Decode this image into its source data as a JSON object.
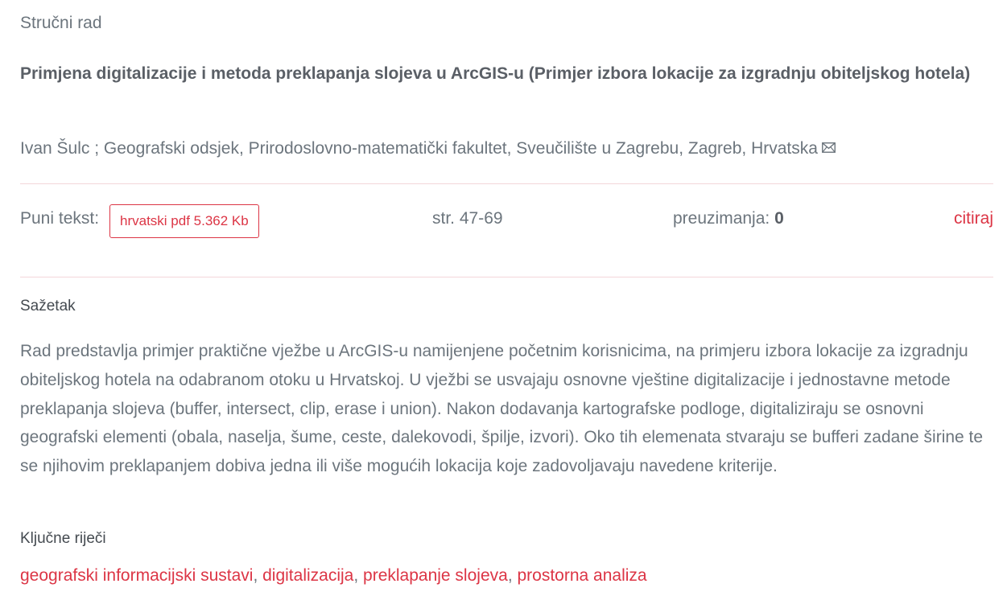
{
  "article": {
    "type": "Stručni rad",
    "title": "Primjena digitalizacije i metoda preklapanja slojeva u ArcGIS-u (Primjer izbora lokacije za izgradnju obiteljskog hotela)",
    "authors": "Ivan Šulc ; Geografski odsjek, Prirodoslovno-matematički fakultet, Sveučilište u Zagrebu, Zagreb, Hrvatska",
    "email_icon": "mail-icon"
  },
  "fulltext": {
    "label": "Puni tekst:",
    "pdf_button": "hrvatski pdf 5.362 Kb",
    "pages": "str. 47-69",
    "downloads_label": "preuzimanja: ",
    "downloads_count": "0",
    "cite_link": "citiraj"
  },
  "abstract": {
    "heading": "Sažetak",
    "text": "Rad predstavlja primjer praktične vježbe u ArcGIS-u namijenjene početnim korisnicima, na primjeru izbora lokacije za izgradnju obiteljskog hotela na odabranom otoku u Hrvatskoj. U vježbi se usvajaju osnovne vještine digitalizacije i jednostavne metode preklapanja slojeva (buffer, intersect, clip, erase i union). Nakon dodavanja kartografske podloge, digitaliziraju se osnovni geografski elementi (obala, naselja, šume, ceste, dalekovodi, špilje, izvori). Oko tih elemenata stvaraju se bufferi zadane širine te se njihovim preklapanjem dobiva jedna ili više mogućih lokacija koje zadovoljavaju navedene kriterije."
  },
  "keywords": {
    "heading": "Ključne riječi",
    "items": [
      "geografski informacijski sustavi",
      "digitalizacija",
      "preklapanje slojeva",
      "prostorna analiza"
    ],
    "separator": ", "
  },
  "colors": {
    "accent": "#dc3545",
    "text": "#6c757d",
    "divider": "#f3d6da"
  }
}
